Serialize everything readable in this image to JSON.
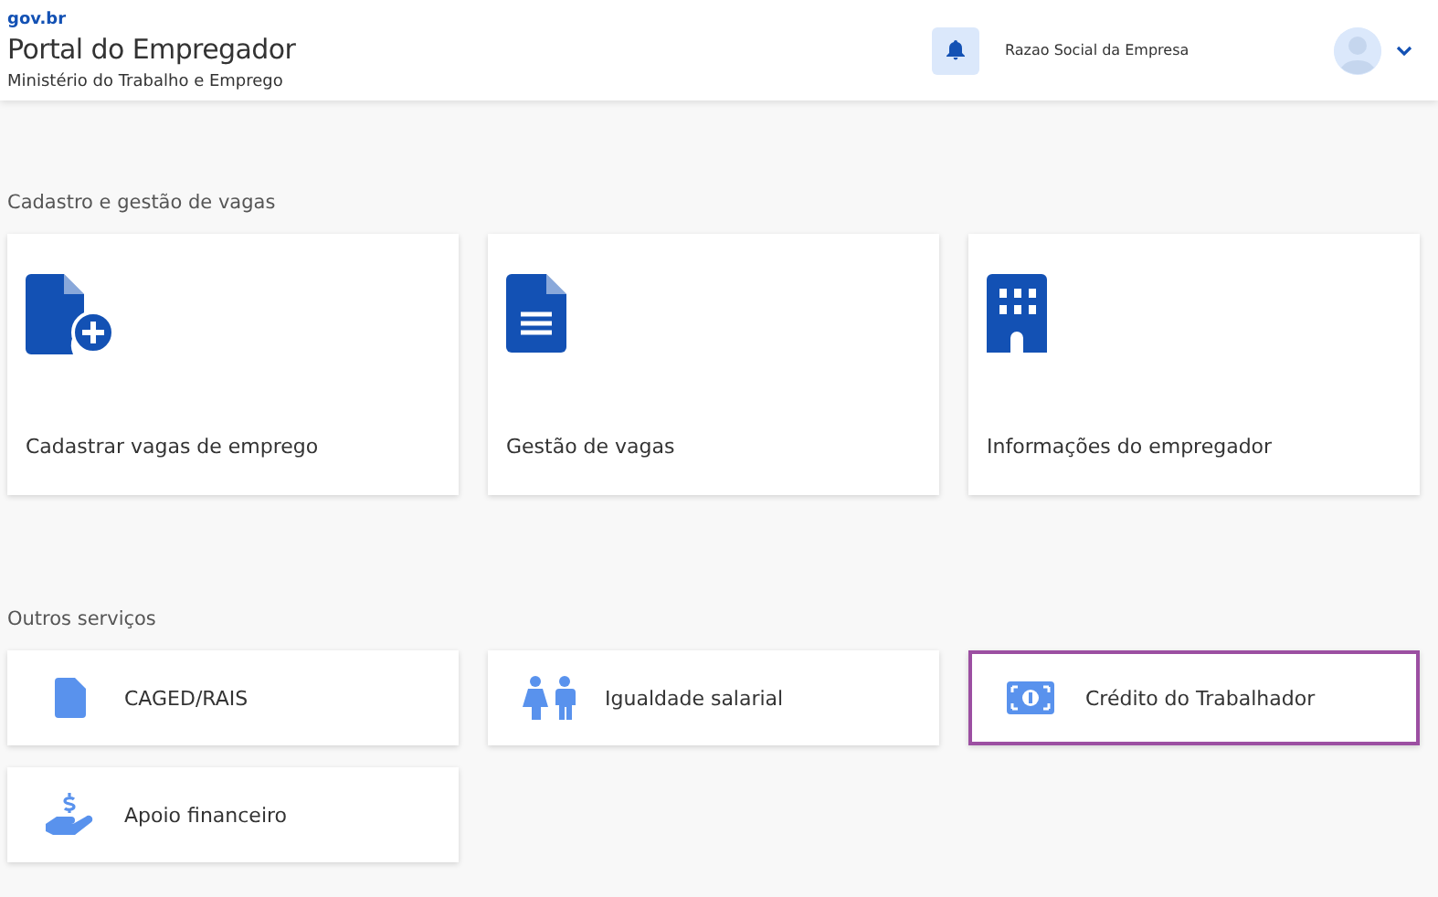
{
  "header": {
    "logo": "gov.br",
    "title": "Portal do Empregador",
    "subtitle": "Ministério do Trabalho e Emprego",
    "company": "Razao Social da Empresa"
  },
  "sections": [
    {
      "title": "Cadastro e gestão de vagas",
      "kind": "tiles",
      "cards": [
        {
          "label": "Cadastrar vagas de emprego",
          "kind": "file-plus",
          "selected": false
        },
        {
          "label": "Gestão de vagas",
          "kind": "document",
          "selected": false
        },
        {
          "label": "Informações do empregador",
          "kind": "building",
          "selected": false
        }
      ]
    },
    {
      "title": "Outros serviços",
      "kind": "rows",
      "cards": [
        {
          "label": "CAGED/RAIS",
          "kind": "file",
          "selected": false
        },
        {
          "label": "Igualdade salarial",
          "kind": "people",
          "selected": false
        },
        {
          "label": "Crédito do Trabalhador",
          "kind": "money",
          "selected": true
        },
        {
          "label": "Apoio financeiro",
          "kind": "hand",
          "selected": false
        }
      ]
    }
  ]
}
